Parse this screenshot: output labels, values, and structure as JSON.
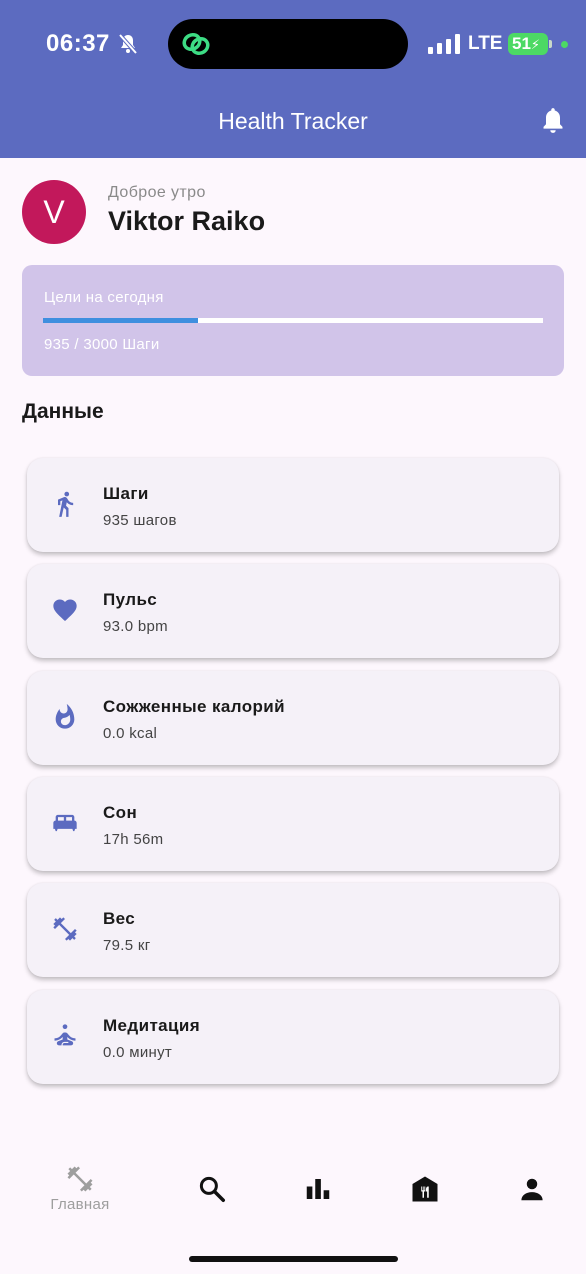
{
  "status_bar": {
    "time": "06:37",
    "network": "LTE",
    "battery": "51"
  },
  "app_bar": {
    "title": "Health Tracker"
  },
  "user": {
    "initial": "V",
    "greeting": "Доброе утро",
    "name": "Viktor Raiko"
  },
  "goals": {
    "title": "Цели на сегодня",
    "progress_text": "935 / 3000 Шаги",
    "progress_fraction": 0.31
  },
  "section": {
    "title": "Данные"
  },
  "cards": [
    {
      "icon": "walking-icon",
      "title": "Шаги",
      "value": "935 шагов"
    },
    {
      "icon": "heart-icon",
      "title": "Пульс",
      "value": "93.0 bpm"
    },
    {
      "icon": "fire-icon",
      "title": "Сожженные калорий",
      "value": "0.0 kcal"
    },
    {
      "icon": "bed-icon",
      "title": "Сон",
      "value": "17h 56m"
    },
    {
      "icon": "dumbbell-icon",
      "title": "Вес",
      "value": "79.5 кг"
    },
    {
      "icon": "meditation-icon",
      "title": "Медитация",
      "value": "0.0 минут"
    }
  ],
  "bottom_nav": {
    "home_label": "Главная"
  },
  "colors": {
    "primary": "#5c6bc0",
    "avatar": "#c2185b",
    "goals_bg": "#d1c4e9",
    "progress": "#3f8fdf",
    "battery": "#4cd964"
  }
}
